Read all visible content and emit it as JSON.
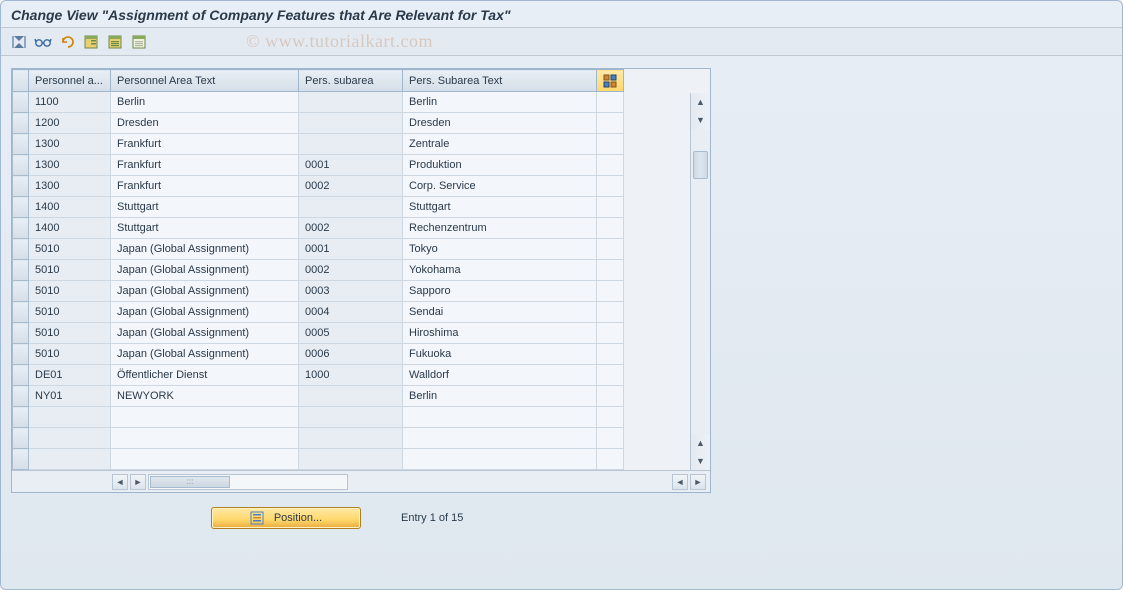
{
  "title": "Change View \"Assignment of Company Features that Are Relevant for Tax\"",
  "watermark": "© www.tutorialkart.com",
  "toolbar": {
    "icons": [
      "other-view",
      "glasses",
      "undo",
      "save-variant",
      "select-all",
      "deselect-all"
    ]
  },
  "columns": [
    "Personnel a...",
    "Personnel Area Text",
    "Pers. subarea",
    "Pers. Subarea Text"
  ],
  "rows": [
    {
      "pa": "1100",
      "patext": "Berlin",
      "sub": "",
      "subtext": "Berlin"
    },
    {
      "pa": "1200",
      "patext": "Dresden",
      "sub": "",
      "subtext": "Dresden"
    },
    {
      "pa": "1300",
      "patext": "Frankfurt",
      "sub": "",
      "subtext": "Zentrale"
    },
    {
      "pa": "1300",
      "patext": "Frankfurt",
      "sub": "0001",
      "subtext": "Produktion"
    },
    {
      "pa": "1300",
      "patext": "Frankfurt",
      "sub": "0002",
      "subtext": "Corp. Service"
    },
    {
      "pa": "1400",
      "patext": "Stuttgart",
      "sub": "",
      "subtext": "Stuttgart"
    },
    {
      "pa": "1400",
      "patext": "Stuttgart",
      "sub": "0002",
      "subtext": "Rechenzentrum"
    },
    {
      "pa": "5010",
      "patext": "Japan (Global Assignment)",
      "sub": "0001",
      "subtext": "Tokyo"
    },
    {
      "pa": "5010",
      "patext": "Japan (Global Assignment)",
      "sub": "0002",
      "subtext": "Yokohama"
    },
    {
      "pa": "5010",
      "patext": "Japan (Global Assignment)",
      "sub": "0003",
      "subtext": "Sapporo"
    },
    {
      "pa": "5010",
      "patext": "Japan (Global Assignment)",
      "sub": "0004",
      "subtext": "Sendai"
    },
    {
      "pa": "5010",
      "patext": "Japan (Global Assignment)",
      "sub": "0005",
      "subtext": "Hiroshima"
    },
    {
      "pa": "5010",
      "patext": "Japan (Global Assignment)",
      "sub": "0006",
      "subtext": "Fukuoka"
    },
    {
      "pa": "DE01",
      "patext": "Öffentlicher Dienst",
      "sub": "1000",
      "subtext": "Walldorf"
    },
    {
      "pa": "NY01",
      "patext": "NEWYORK",
      "sub": "",
      "subtext": "Berlin"
    }
  ],
  "empty_rows": 3,
  "footer": {
    "position_label": "Position...",
    "entry_text": "Entry 1 of 15"
  }
}
